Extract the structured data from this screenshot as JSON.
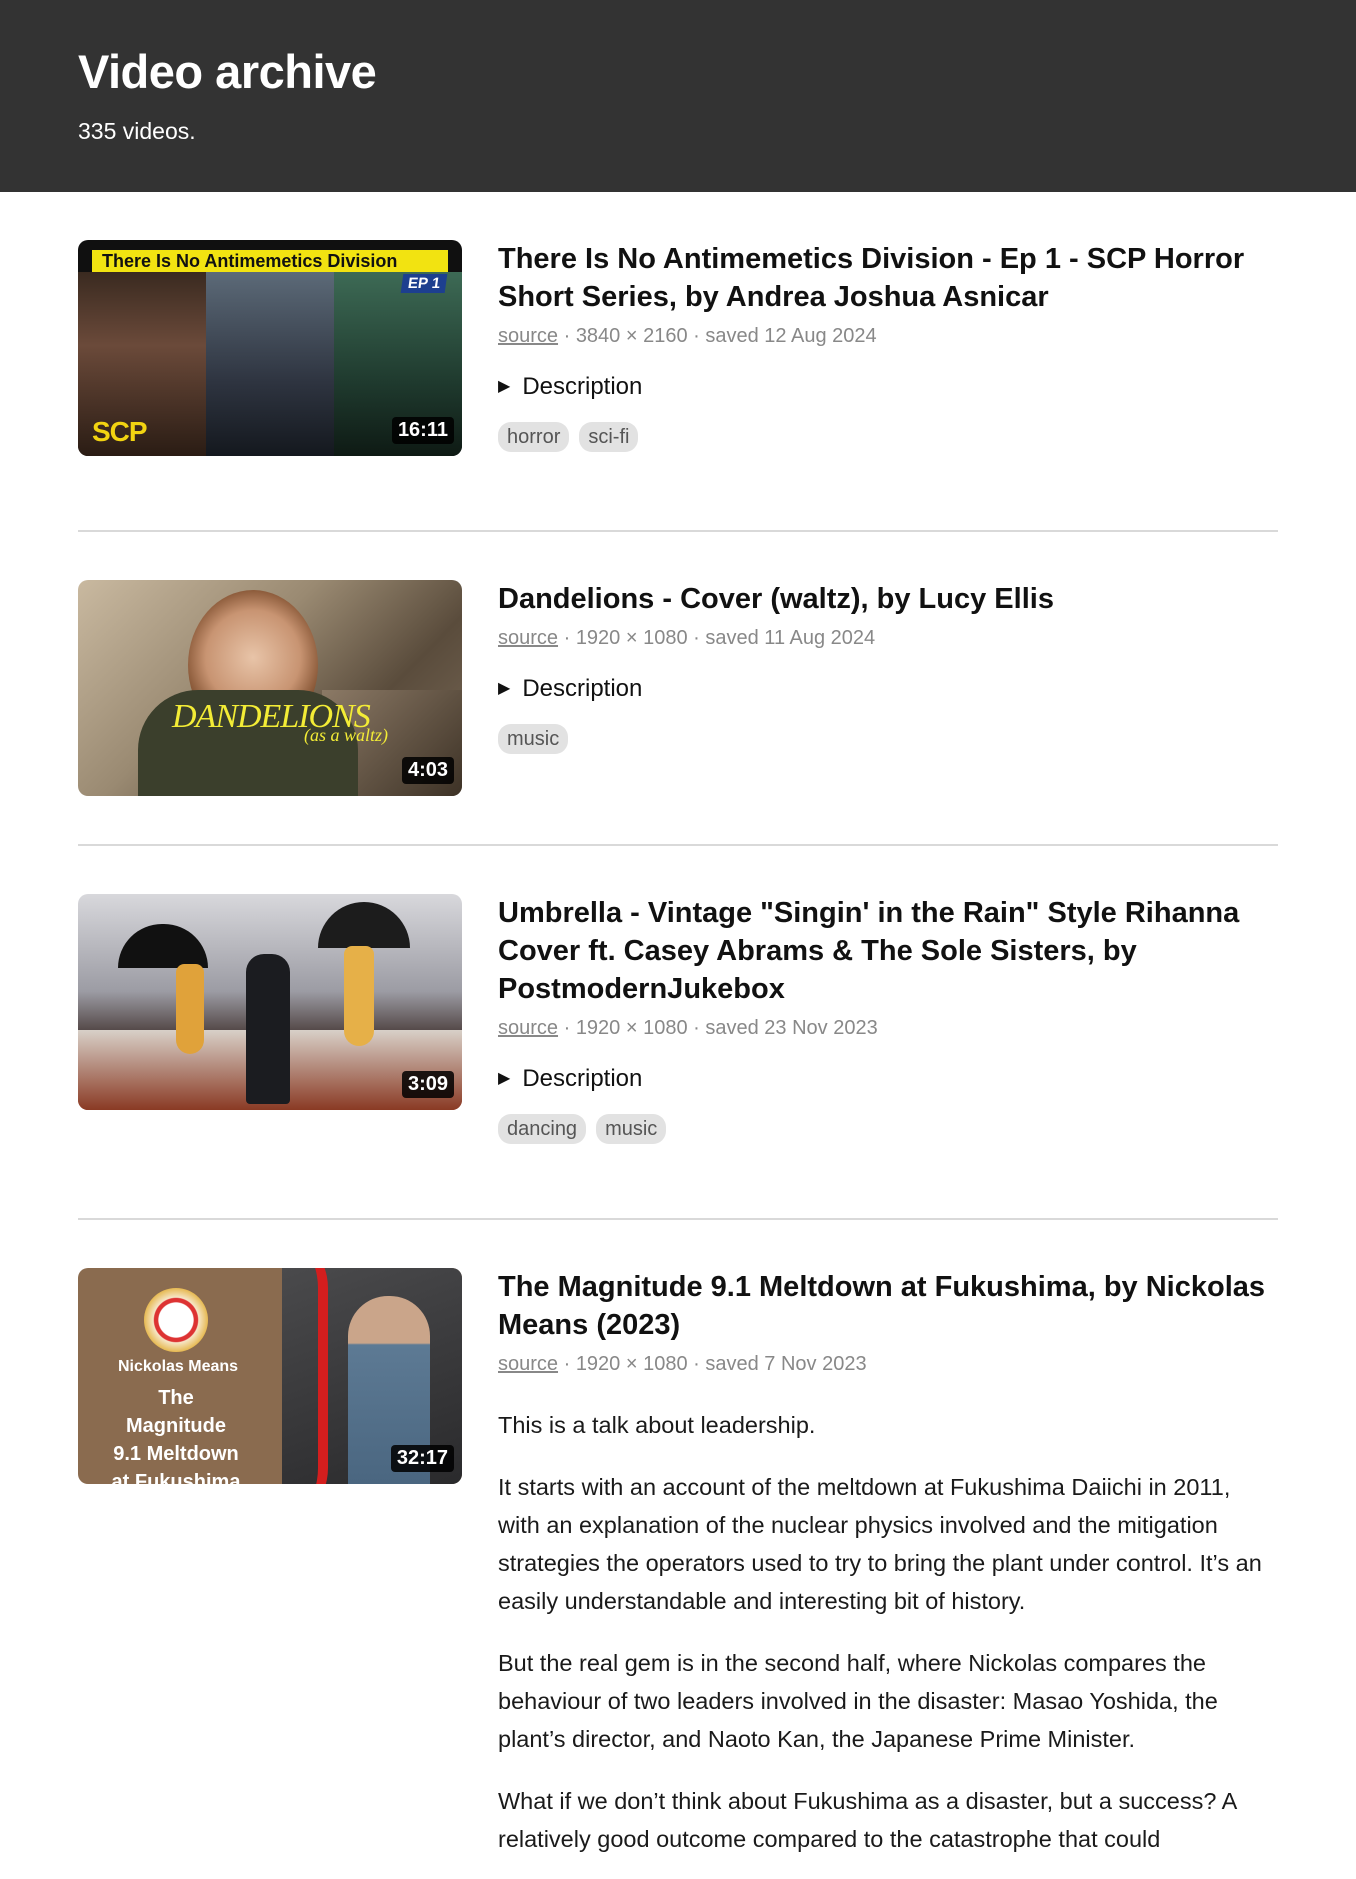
{
  "header": {
    "title": "Video archive",
    "count": "335 videos."
  },
  "videos": [
    {
      "title": "There Is No Antimemetics Division - Ep 1 - SCP Horror Short Series, by Andrea Joshua Asnicar",
      "source": "source",
      "resolution": "3840 × 2160",
      "saved": "saved 12 Aug 2024",
      "duration": "16:11",
      "description_label": "Description",
      "tags": [
        "horror",
        "sci-fi"
      ],
      "thumb_text": {
        "band": "There Is No Antimemetics Division",
        "ep": "EP 1",
        "logo": "SCP"
      }
    },
    {
      "title": "Dandelions - Cover (waltz), by Lucy Ellis",
      "source": "source",
      "resolution": "1920 × 1080",
      "saved": "saved 11 Aug 2024",
      "duration": "4:03",
      "description_label": "Description",
      "tags": [
        "music"
      ],
      "thumb_text": {
        "word": "DANDELIONS",
        "sub": "(as a waltz)"
      }
    },
    {
      "title": "Umbrella - Vintage \"Singin' in the Rain\" Style Rihanna Cover ft. Casey Abrams & The Sole Sisters, by PostmodernJukebox",
      "source": "source",
      "resolution": "1920 × 1080",
      "saved": "saved 23 Nov 2023",
      "duration": "3:09",
      "description_label": "Description",
      "tags": [
        "dancing",
        "music"
      ]
    },
    {
      "title": "The Magnitude 9.1 Meltdown at Fukushima, by Nickolas Means (2023)",
      "source": "source",
      "resolution": "1920 × 1080",
      "saved": "saved 7 Nov 2023",
      "duration": "32:17",
      "thumb_text": {
        "name": "Nickolas Means",
        "line1": "The Magnitude",
        "line2": "9.1 Meltdown",
        "line3": "at Fukushima"
      },
      "body": [
        "This is a talk about leadership.",
        "It starts with an account of the meltdown at Fukushima Daiichi in 2011, with an explanation of the nuclear physics involved and the mitigation strategies the operators used to try to bring the plant under control. It’s an easily understandable and interesting bit of history.",
        "But the real gem is in the second half, where Nickolas compares the behaviour of two leaders involved in the disaster: Masao Yoshida, the plant’s director, and Naoto Kan, the Japanese Prime Minister.",
        "What if we don’t think about Fukushima as a disaster, but a success? A relatively good outcome compared to the catastrophe that could"
      ]
    }
  ]
}
